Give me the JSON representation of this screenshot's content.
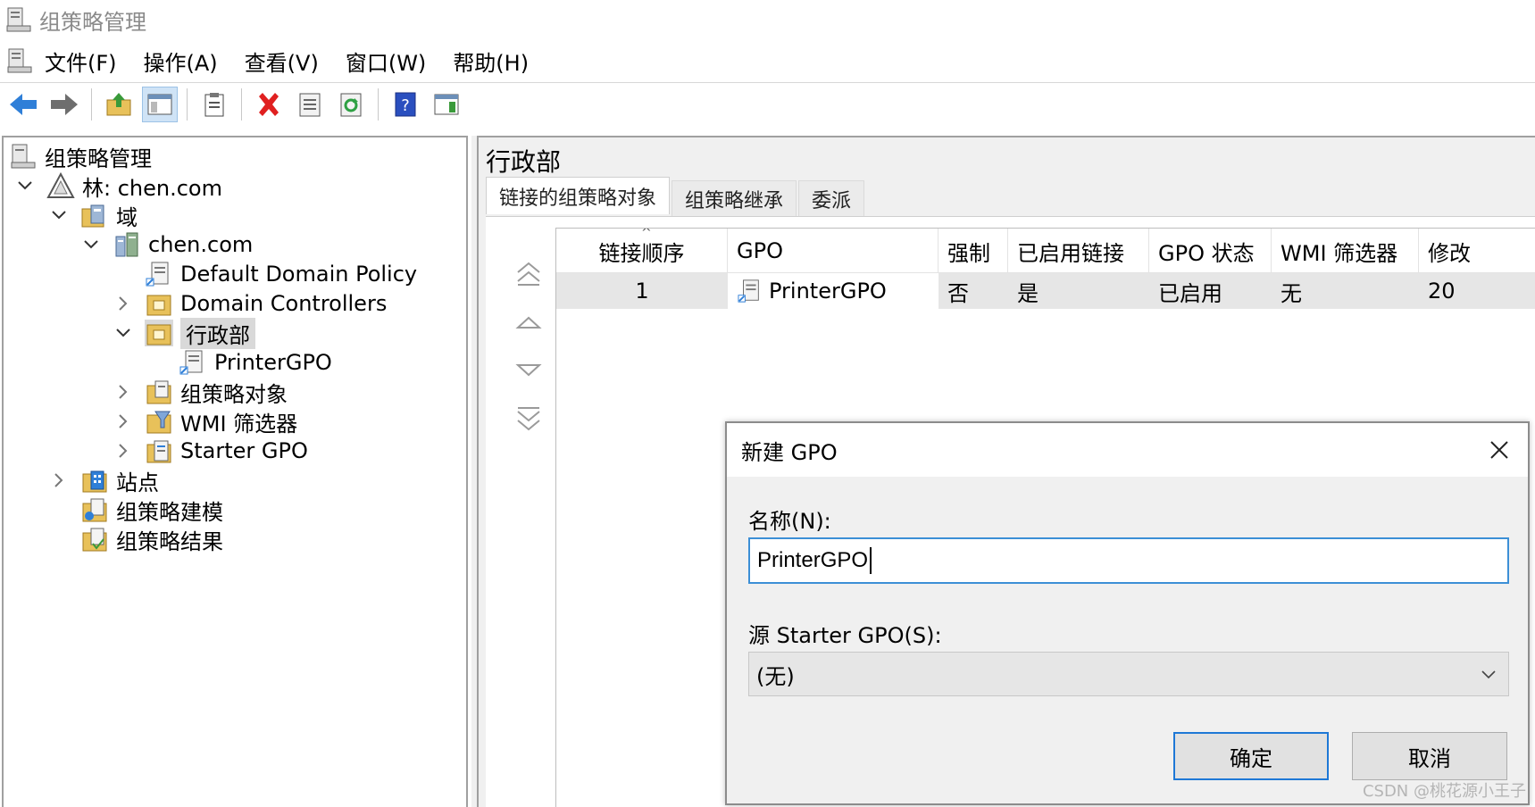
{
  "window": {
    "title": "组策略管理"
  },
  "menu": [
    "文件(F)",
    "操作(A)",
    "查看(V)",
    "窗口(W)",
    "帮助(H)"
  ],
  "toolbar": [
    "back-icon",
    "forward-icon",
    "up-folder-icon",
    "show-hide-tree-icon",
    "clipboard-icon",
    "delete-icon",
    "properties-icon",
    "refresh-icon",
    "help-icon",
    "action-pane-icon"
  ],
  "tree": [
    {
      "label": "组策略管理",
      "icon": "gpm-icon"
    },
    {
      "label": "林: chen.com",
      "icon": "forest-icon"
    },
    {
      "label": "域",
      "icon": "domains-icon"
    },
    {
      "label": "chen.com",
      "icon": "domain-icon"
    },
    {
      "label": "Default Domain Policy",
      "icon": "gpo-link-icon"
    },
    {
      "label": "Domain Controllers",
      "icon": "ou-icon"
    },
    {
      "label": "行政部",
      "icon": "ou-icon"
    },
    {
      "label": "PrinterGPO",
      "icon": "gpo-link-icon"
    },
    {
      "label": "组策略对象",
      "icon": "gpo-folder-icon"
    },
    {
      "label": "WMI 筛选器",
      "icon": "wmi-folder-icon"
    },
    {
      "label": "Starter GPO",
      "icon": "starter-gpo-icon"
    },
    {
      "label": "站点",
      "icon": "sites-icon"
    },
    {
      "label": "组策略建模",
      "icon": "modeling-icon"
    },
    {
      "label": "组策略结果",
      "icon": "results-icon"
    }
  ],
  "right": {
    "title": "行政部",
    "tabs": [
      "链接的组策略对象",
      "组策略继承",
      "委派"
    ],
    "columns": [
      "链接顺序",
      "GPO",
      "强制",
      "已启用链接",
      "GPO 状态",
      "WMI 筛选器",
      "修改"
    ],
    "rows": [
      {
        "order": "1",
        "gpo": "PrinterGPO",
        "enforced": "否",
        "link_enabled": "是",
        "status": "已启用",
        "wmi": "无",
        "modified": "20"
      }
    ]
  },
  "dialog": {
    "title": "新建 GPO",
    "name_label": "名称(N):",
    "name_value": "PrinterGPO",
    "source_label": "源 Starter GPO(S):",
    "source_value": "(无)",
    "ok": "确定",
    "cancel": "取消"
  },
  "watermark": "CSDN @桃花源小王子",
  "colors": {
    "accent": "#1e78d6",
    "selection": "#d9d9d9",
    "input_border": "#3c8fd6"
  }
}
